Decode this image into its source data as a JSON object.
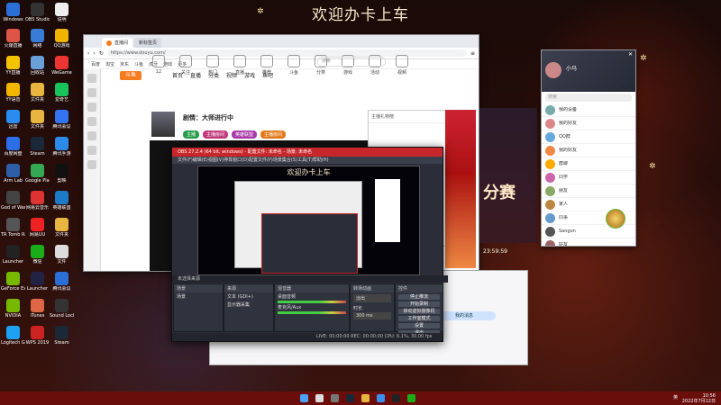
{
  "banner": "欢迎办卡上车",
  "desktop_icons": [
    {
      "label": "Windows",
      "color": "#2b6fd6"
    },
    {
      "label": "OBS Studio",
      "color": "#333"
    },
    {
      "label": "说明",
      "color": "#eee"
    },
    {
      "label": "火爆直播",
      "color": "#d54"
    },
    {
      "label": "网络",
      "color": "#3a7bd5"
    },
    {
      "label": "QQ游戏",
      "color": "#f0b400"
    },
    {
      "label": "YY直播",
      "color": "#f4c300"
    },
    {
      "label": "回收站",
      "color": "#6aa0d8"
    },
    {
      "label": "WeGame",
      "color": "#e33"
    },
    {
      "label": "YY语音",
      "color": "#f2b600"
    },
    {
      "label": "文件夹",
      "color": "#e8b640"
    },
    {
      "label": "爱奇艺",
      "color": "#18c35a"
    },
    {
      "label": "迅雷",
      "color": "#2a8cf0"
    },
    {
      "label": "文件夹",
      "color": "#e8b640"
    },
    {
      "label": "腾讯会议",
      "color": "#3574f0"
    },
    {
      "label": "百度网盘",
      "color": "#2a6ee8"
    },
    {
      "label": "Steam",
      "color": "#1b2838"
    },
    {
      "label": "腾讯手游",
      "color": "#2c8be8"
    },
    {
      "label": "Arm Lab",
      "color": "#2f5ea8"
    },
    {
      "label": "Google Play",
      "color": "#34a853"
    },
    {
      "label": "剪映",
      "color": "#111"
    },
    {
      "label": "God of War",
      "color": "#444"
    },
    {
      "label": "网易云音乐",
      "color": "#d33"
    },
    {
      "label": "英雄联盟",
      "color": "#1d7ac8"
    },
    {
      "label": "TR Tomb Raider",
      "color": "#555"
    },
    {
      "label": "网易UU",
      "color": "#e22"
    },
    {
      "label": "文件夹",
      "color": "#e8b640"
    },
    {
      "label": "Launcher",
      "color": "#222"
    },
    {
      "label": "微信",
      "color": "#1aad19"
    },
    {
      "label": "文件",
      "color": "#ddd"
    },
    {
      "label": "GeForce Experience",
      "color": "#76b900"
    },
    {
      "label": "Launcher",
      "color": "#224"
    },
    {
      "label": "腾讯会议",
      "color": "#2b6fd6"
    },
    {
      "label": "NVIDIA",
      "color": "#76b900"
    },
    {
      "label": "iTunes",
      "color": "#d64"
    },
    {
      "label": "Sound Lock",
      "color": "#333"
    },
    {
      "label": "Logitech G HUB",
      "color": "#1da1f2"
    },
    {
      "label": "WPS 2019",
      "color": "#c22"
    },
    {
      "label": "Steam",
      "color": "#1b2838"
    }
  ],
  "browser": {
    "tabs": [
      "直播间",
      "新标签页"
    ],
    "url": "https://www.douyu.com/",
    "bookmarks": [
      "百度",
      "淘宝",
      "京东",
      "斗鱼",
      "虎牙",
      "游戏",
      "更多"
    ],
    "nav": [
      "首页",
      "直播",
      "分类",
      "视频",
      "游戏",
      "鱼吧"
    ],
    "search_placeholder": "搜索",
    "categories": [
      "12",
      "关注",
      "热门",
      "直播",
      "推荐",
      "斗鱼",
      "分类",
      "游戏",
      "活动",
      "视频"
    ],
    "room_title": "剧情：大师进行中",
    "tags": [
      {
        "text": "主播",
        "color": "#2a9d4a"
      },
      {
        "text": "主播房间",
        "color": "#c23a7a"
      },
      {
        "text": "英雄联盟",
        "color": "#a83aa8"
      },
      {
        "text": "主播房间",
        "color": "#e47a1a"
      }
    ],
    "right_panel_header": "主播礼物榜"
  },
  "live_ad": {
    "big": "分赛",
    "timer": "23:59:59"
  },
  "obs": {
    "title": "OBS 27.2.4 (64 bit, windows) - 配置文件: 未命名 - 场景: 未命名",
    "menu": [
      "文件(F)",
      "编辑(E)",
      "视图(V)",
      "停靠窗口(D)",
      "配置文件(P)",
      "场景集合(S)",
      "工具(T)",
      "帮助(H)"
    ],
    "preview_banner": "欢迎办卡上车",
    "bar_label": "未选择来源",
    "scenes_header": "场景",
    "scenes": [
      "场景"
    ],
    "sources_header": "来源",
    "sources": [
      "文本 (GDI+)",
      "显示器采集"
    ],
    "mixer_header": "混音器",
    "mixer": [
      "桌面音频",
      "麦克风/Aux"
    ],
    "transitions_header": "转场动画",
    "transition_value": "淡出",
    "duration_label": "时长",
    "duration_value": "300 ms",
    "controls_header": "控件",
    "controls": [
      "停止推流",
      "开始录制",
      "启动虚拟摄像机",
      "工作室模式",
      "设置",
      "退出"
    ],
    "status": "LIVE: 00:00:00   REC: 00:00:00   CPU: 6.1%, 30.00 fps"
  },
  "chat": {
    "bubble": "我的消息"
  },
  "qq": {
    "name": "小马",
    "search": "搜索",
    "items": [
      {
        "name": "我的设备",
        "color": "#7aa"
      },
      {
        "name": "我的好友",
        "color": "#d88"
      },
      {
        "name": "QQ群",
        "color": "#6ad"
      },
      {
        "name": "我的好友",
        "color": "#e84"
      },
      {
        "name": "群聊",
        "color": "#fa0"
      },
      {
        "name": "同学",
        "color": "#c6a"
      },
      {
        "name": "朋友",
        "color": "#8a6"
      },
      {
        "name": "家人",
        "color": "#b84"
      },
      {
        "name": "同事",
        "color": "#69c"
      },
      {
        "name": "Sangon",
        "color": "#555"
      },
      {
        "name": "好友",
        "color": "#966"
      }
    ]
  },
  "taskbar": {
    "time": "10:56",
    "date": "2022年7月12日",
    "tray": "英"
  }
}
